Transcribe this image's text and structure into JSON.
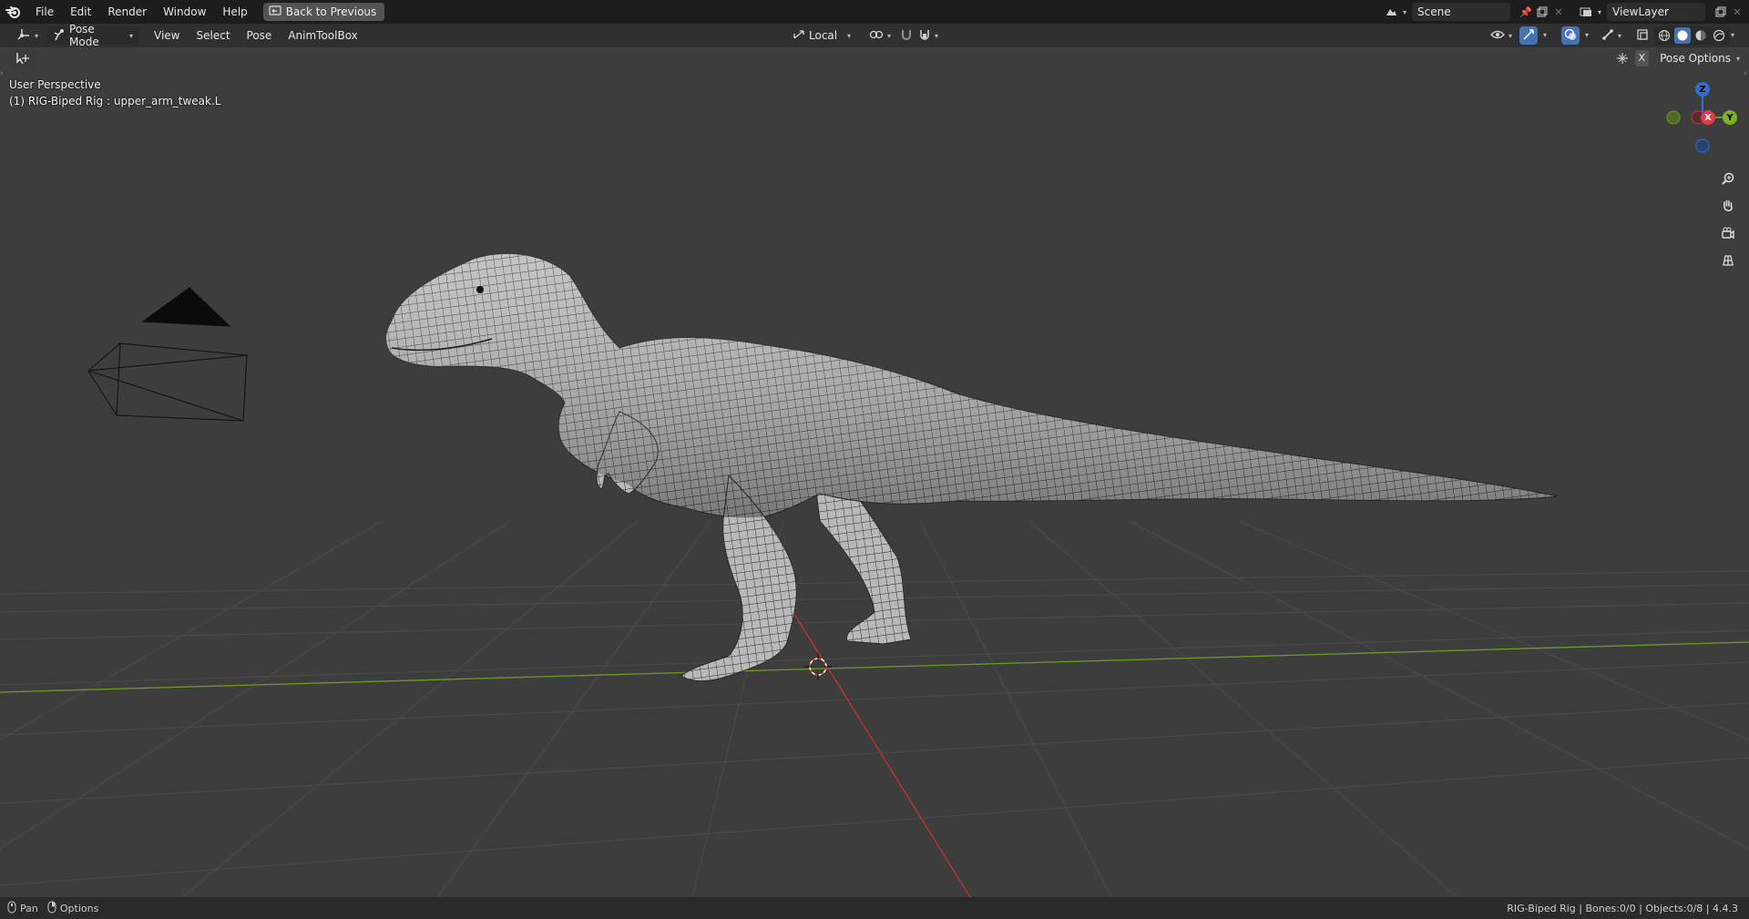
{
  "topbar": {
    "menu": [
      "File",
      "Edit",
      "Render",
      "Window",
      "Help"
    ],
    "back_button": "Back to Previous",
    "scene_name": "Scene",
    "view_layer": "ViewLayer"
  },
  "header": {
    "mode": "Pose Mode",
    "menus": [
      "View",
      "Select",
      "Pose",
      "AnimToolBox"
    ],
    "transform_orientation": "Local",
    "pose_options": "Pose Options",
    "x_label": "X"
  },
  "viewport": {
    "view_name": "User Perspective",
    "active_object": "(1) RIG-Biped Rig : upper_arm_tweak.L",
    "gizmo": {
      "z": "Z",
      "x": "X",
      "y": "Y"
    }
  },
  "statusbar": {
    "pan": "Pan",
    "options": "Options",
    "right_info": "RIG-Biped Rig | Bones:0/0 | Objects:0/8 | 4.4.3"
  },
  "colors": {
    "topbar_bg": "#1d1d1d",
    "header_bg": "#303030",
    "viewport_bg": "#3d3d3d",
    "axis_x": "#c8303a",
    "axis_y": "#6c9a25",
    "axis_z": "#2f6fd1"
  }
}
